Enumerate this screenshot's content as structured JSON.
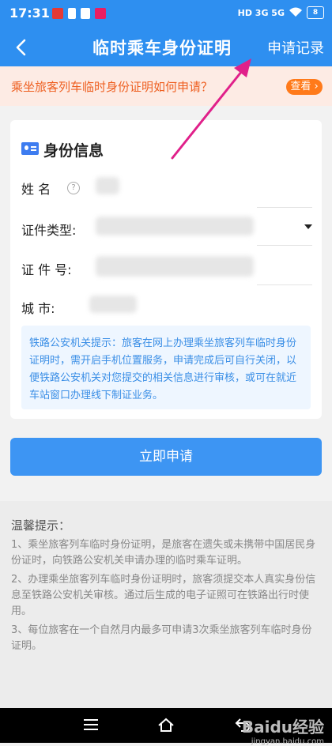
{
  "status_bar": {
    "time": "17:31",
    "network": "HD 3G 5G",
    "battery": "8"
  },
  "header": {
    "title": "临时乘车身份证明",
    "records_link": "申请记录"
  },
  "notice": {
    "text": "乘坐旅客列车临时身份证明如何申请？",
    "button": "查看"
  },
  "card": {
    "title": "身份信息",
    "fields": {
      "name": {
        "label": "姓    名"
      },
      "id_type": {
        "label": "证件类型:"
      },
      "id_number": {
        "label": "证  件  号:"
      },
      "city": {
        "label": "城        市:"
      }
    },
    "tip": "铁路公安机关提示：旅客在网上办理乘坐旅客列车临时身份证明时，需开启手机位置服务，申请完成后可自行关闭，以便铁路公安机关对您提交的相关信息进行审核，或可在就近车站窗口办理线下制证业务。"
  },
  "apply_button": "立即申请",
  "warm_tips": {
    "title": "温馨提示：",
    "items": [
      "1、乘坐旅客列车临时身份证明，是旅客在遗失或未携带中国居民身份证时，向铁路公安机关申请办理的临时乘车证明。",
      "2、办理乘坐旅客列车临时身份证明时，旅客须提交本人真实身份信息至铁路公安机关审核。通过后生成的电子证照可在铁路出行时使用。",
      "3、每位旅客在一个自然月内最多可申请3次乘坐旅客列车临时身份证明。"
    ]
  },
  "watermark": {
    "brand": "Baidu经验",
    "url": "jingyan.baidu.com"
  },
  "colors": {
    "primary": "#2e8ff0",
    "accent": "#ff7a1a",
    "annotation_arrow": "#e0208a"
  }
}
